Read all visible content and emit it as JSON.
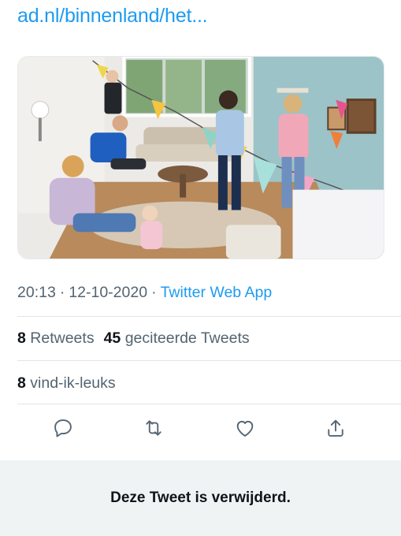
{
  "link_card": {
    "text": "ad.nl/binnenland/het..."
  },
  "media": {
    "alt": "Family celebrating indoors with colorful bunting"
  },
  "meta": {
    "time": "20:13",
    "separator": "·",
    "date": "12-10-2020",
    "source": "Twitter Web App"
  },
  "stats": {
    "retweets_count": "8",
    "retweets_label": "Retweets",
    "quotes_count": "45",
    "quotes_label": "geciteerde Tweets",
    "likes_count": "8",
    "likes_label": "vind-ik-leuks"
  },
  "actions": {
    "reply_icon": "reply-icon",
    "retweet_icon": "retweet-icon",
    "like_icon": "heart-icon",
    "share_icon": "share-icon",
    "color": "#536471"
  },
  "banner": {
    "text": "Deze Tweet is verwijderd."
  },
  "colors": {
    "accent": "#1d9bf0",
    "muted": "#536471",
    "banner_bg": "#eff3f4"
  }
}
